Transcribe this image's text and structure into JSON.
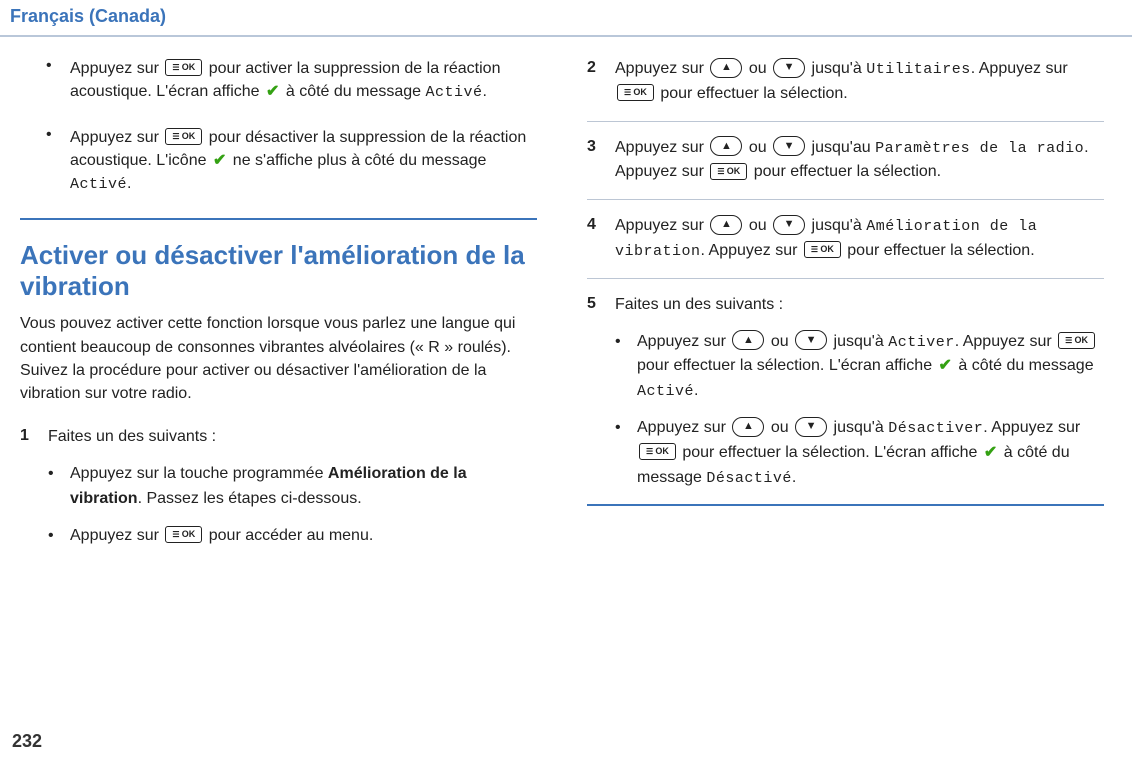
{
  "header": {
    "title": "Français (Canada)"
  },
  "left": {
    "bullets": [
      {
        "t1": "Appuyez sur ",
        "t2": " pour activer la suppression de la réaction acoustique. L'écran affiche ",
        "t3": " à côté du message ",
        "code": "Activé",
        "t4": "."
      },
      {
        "t1": "Appuyez sur ",
        "t2": " pour désactiver la suppression de la réaction acoustique. L'icône ",
        "t3": " ne s'affiche plus à côté du message ",
        "code": "Activé",
        "t4": "."
      }
    ],
    "section": {
      "title": "Activer ou désactiver l'amélioration de la vibration",
      "desc": "Vous pouvez activer cette fonction lorsque vous parlez une langue qui contient beaucoup de consonnes vibrantes alvéolaires (« R » roulés). Suivez la procédure pour activer ou désactiver l'amélioration de la vibration sur votre radio."
    },
    "step1": {
      "num": "1",
      "intro": "Faites un des suivants :",
      "s1a": "Appuyez sur la touche programmée ",
      "s1b": "Amélioration de la vibration",
      "s1c": ". Passez les étapes ci-dessous.",
      "s2a": "Appuyez sur ",
      "s2b": " pour accéder au menu."
    }
  },
  "right": {
    "step2": {
      "num": "2",
      "a": "Appuyez sur ",
      "b": " ou ",
      "c": " jusqu'à ",
      "code": "Utilitaires",
      "d": ". Appuyez sur ",
      "e": " pour effectuer la sélection."
    },
    "step3": {
      "num": "3",
      "a": "Appuyez sur ",
      "b": " ou ",
      "c": " jusqu'au ",
      "code": "Paramètres de la radio",
      "d": ". Appuyez sur ",
      "e": " pour effectuer la sélection."
    },
    "step4": {
      "num": "4",
      "a": "Appuyez sur ",
      "b": " ou ",
      "c": " jusqu'à ",
      "code": "Amélioration de la vibration",
      "d": ". Appuyez sur ",
      "e": " pour effectuer la sélection."
    },
    "step5": {
      "num": "5",
      "intro": "Faites un des suivants :",
      "opt1": {
        "a": "Appuyez sur ",
        "b": " ou ",
        "c": " jusqu'à ",
        "code1": "Activer",
        "d": ". Appuyez sur ",
        "e": " pour effectuer la sélection. L'écran affiche ",
        "f": " à côté du message ",
        "code2": "Activé",
        "g": "."
      },
      "opt2": {
        "a": "Appuyez sur ",
        "b": " ou ",
        "c": " jusqu'à ",
        "code1": "Désactiver",
        "d": ". Appuyez sur ",
        "e": " pour effectuer la sélection. L'écran affiche ",
        "f": " à côté du message ",
        "code2": "Désactivé",
        "g": "."
      }
    }
  },
  "page": "232",
  "icons": {
    "ok": "OK",
    "check": "✔"
  }
}
